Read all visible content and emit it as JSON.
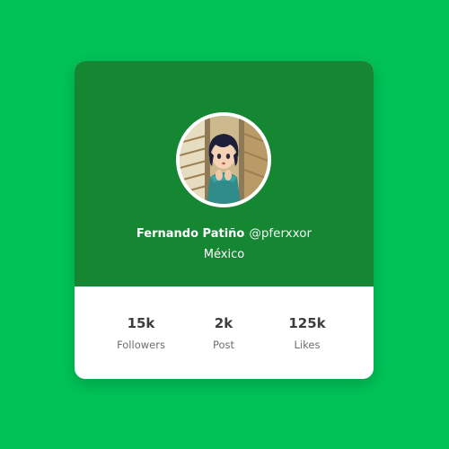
{
  "profile": {
    "name": "Fernando Patiño",
    "handle": "@pferxxor",
    "location": "México"
  },
  "stats": [
    {
      "value": "15k",
      "label": "Followers"
    },
    {
      "value": "2k",
      "label": "Post"
    },
    {
      "value": "125k",
      "label": "Likes"
    }
  ],
  "colors": {
    "page_background": "#00c257",
    "card_header": "#158632",
    "card_body": "#ffffff"
  }
}
